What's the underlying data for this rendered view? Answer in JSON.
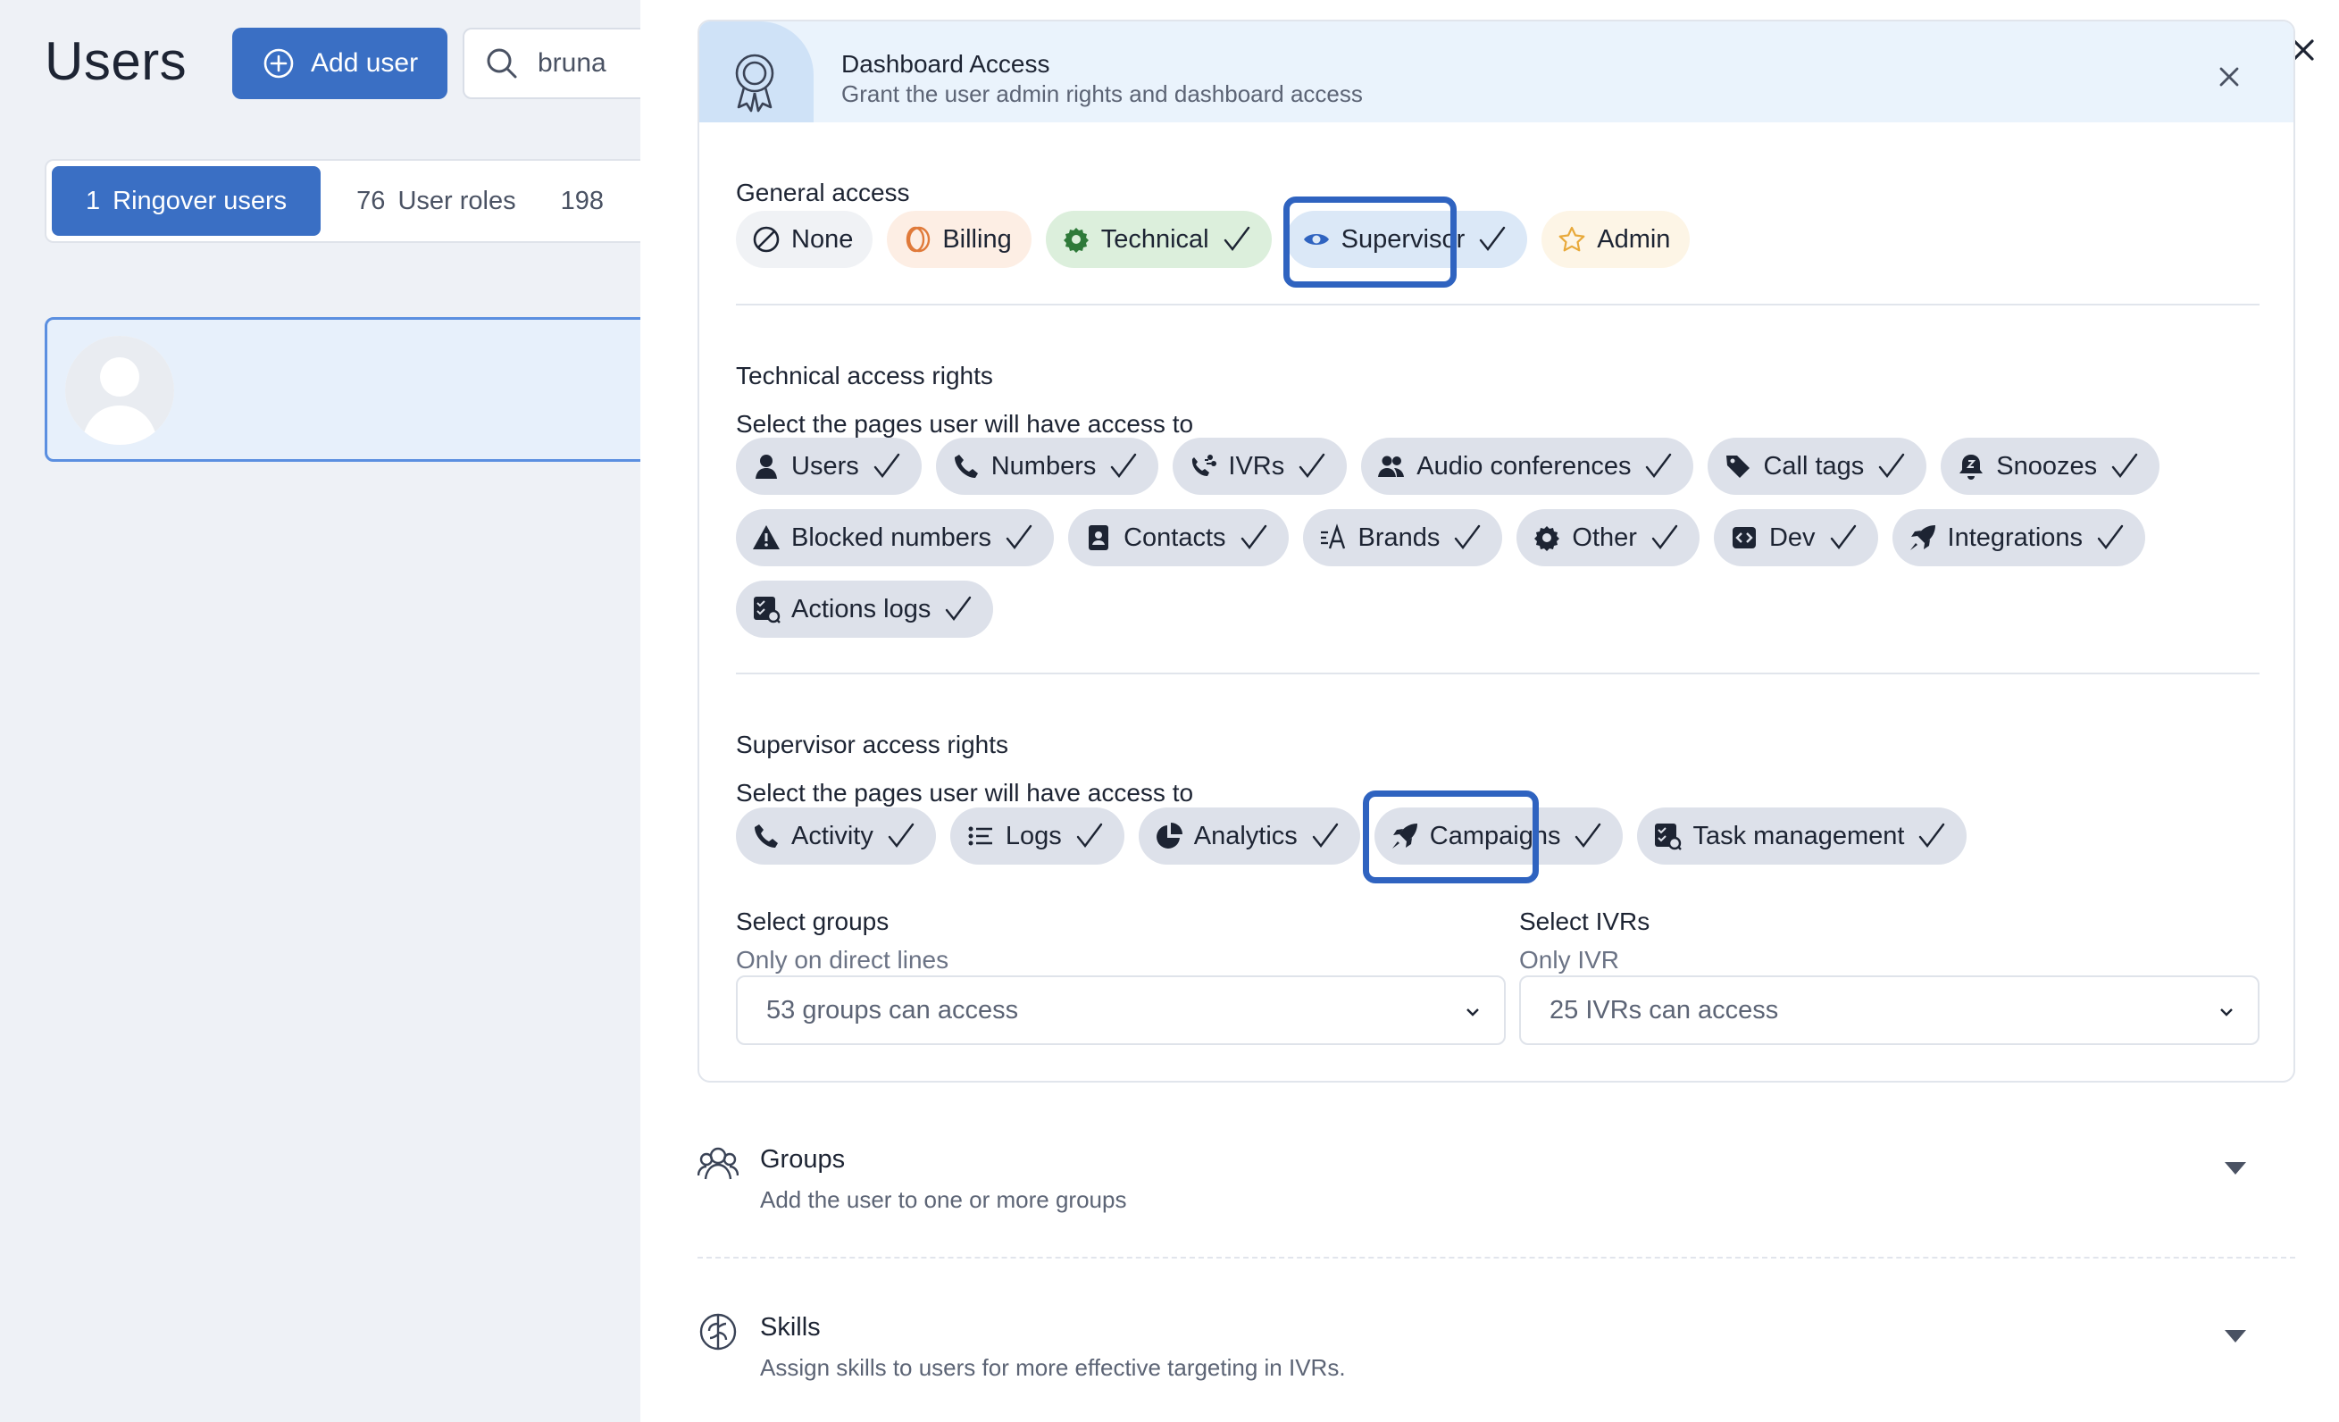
{
  "left": {
    "title": "Users",
    "add_user_label": "Add user",
    "search_value": "bruna",
    "tabs": [
      {
        "count": "1",
        "label": "Ringover users",
        "active": true
      },
      {
        "count": "76",
        "label": "User roles",
        "active": false
      },
      {
        "count": "198",
        "label": "",
        "active": false
      }
    ]
  },
  "access": {
    "title": "Dashboard Access",
    "subtitle": "Grant the user admin rights and dashboard access",
    "general": {
      "label": "General access",
      "chips": [
        {
          "label": "None",
          "icon": "none-icon",
          "checked": false
        },
        {
          "label": "Billing",
          "icon": "billing-icon",
          "checked": false
        },
        {
          "label": "Technical",
          "icon": "gear-icon",
          "checked": true
        },
        {
          "label": "Supervisor",
          "icon": "eye-icon",
          "checked": true
        },
        {
          "label": "Admin",
          "icon": "star-icon",
          "checked": false
        }
      ]
    },
    "technical": {
      "label": "Technical access rights",
      "sub": "Select the pages user will have access to",
      "chips": [
        {
          "label": "Users",
          "icon": "user-icon"
        },
        {
          "label": "Numbers",
          "icon": "phone-icon"
        },
        {
          "label": "IVRs",
          "icon": "ivr-icon"
        },
        {
          "label": "Audio conferences",
          "icon": "people-icon"
        },
        {
          "label": "Call tags",
          "icon": "tag-icon"
        },
        {
          "label": "Snoozes",
          "icon": "snooze-icon"
        },
        {
          "label": "Blocked numbers",
          "icon": "warning-icon"
        },
        {
          "label": "Contacts",
          "icon": "contact-icon"
        },
        {
          "label": "Brands",
          "icon": "brands-icon"
        },
        {
          "label": "Other",
          "icon": "gear-icon"
        },
        {
          "label": "Dev",
          "icon": "code-icon"
        },
        {
          "label": "Integrations",
          "icon": "rocket-icon"
        },
        {
          "label": "Actions logs",
          "icon": "log-icon"
        }
      ]
    },
    "supervisor": {
      "label": "Supervisor access rights",
      "sub": "Select the pages user will have access to",
      "chips": [
        {
          "label": "Activity",
          "icon": "phone-icon"
        },
        {
          "label": "Logs",
          "icon": "list-icon"
        },
        {
          "label": "Analytics",
          "icon": "pie-icon"
        },
        {
          "label": "Campaigns",
          "icon": "rocket-icon"
        },
        {
          "label": "Task management",
          "icon": "task-icon"
        }
      ]
    },
    "groups_field": {
      "label": "Select groups",
      "sub": "Only on direct lines",
      "value": "53 groups can access"
    },
    "ivrs_field": {
      "label": "Select IVRs",
      "sub": "Only IVR",
      "value": "25 IVRs can access"
    }
  },
  "sections": [
    {
      "title": "Groups",
      "subtitle": "Add the user to one or more groups",
      "icon": "groups-icon"
    },
    {
      "title": "Skills",
      "subtitle": "Assign skills to users for more effective targeting in IVRs.",
      "icon": "brain-icon"
    }
  ],
  "colors": {
    "accent": "#3a6fc4",
    "highlight": "#2f63c0"
  }
}
